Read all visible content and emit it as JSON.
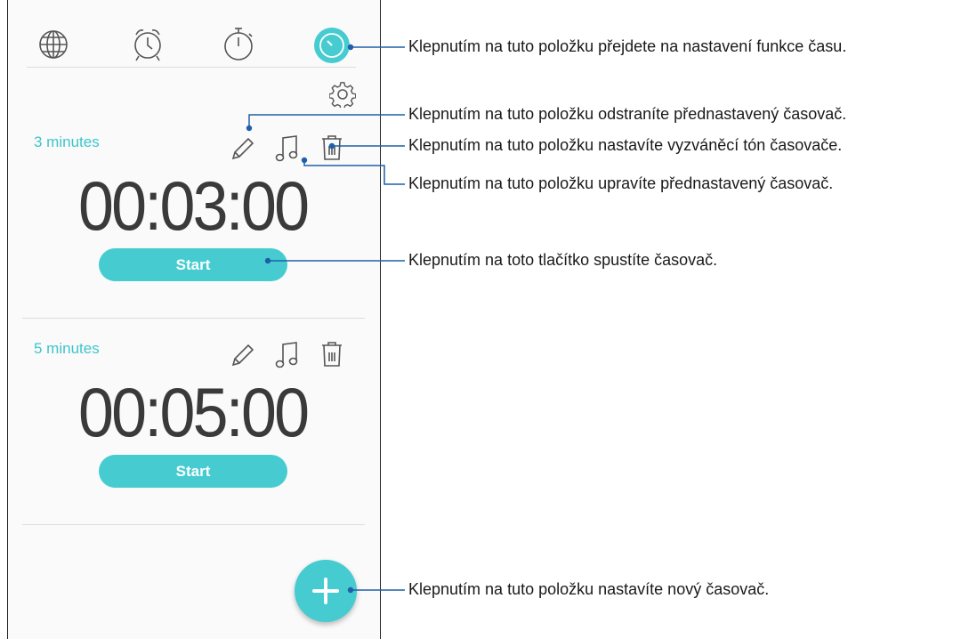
{
  "tabs": [
    {
      "name": "world-clock",
      "icon": "globe-icon"
    },
    {
      "name": "alarm",
      "icon": "alarm-clock-icon"
    },
    {
      "name": "stopwatch",
      "icon": "stopwatch-icon"
    },
    {
      "name": "timer",
      "icon": "timer-icon",
      "active": true
    }
  ],
  "timers": [
    {
      "label": "3 minutes",
      "time": "00:03:00",
      "start_label": "Start"
    },
    {
      "label": "5 minutes",
      "time": "00:05:00",
      "start_label": "Start"
    }
  ],
  "icons": {
    "settings": "gear-icon",
    "edit": "pencil-icon",
    "ringtone": "music-note-icon",
    "delete": "trash-icon",
    "add": "plus-icon"
  },
  "callouts": {
    "timer_settings": "Klepnutím na tuto položku přejdete na nastavení funkce času.",
    "delete_preset": "Klepnutím na tuto položku odstraníte přednastavený časovač.",
    "ringtone": "Klepnutím na tuto položku nastavíte vyzváněcí tón časovače.",
    "edit_preset": "Klepnutím na tuto položku upravíte přednastavený časovač.",
    "start": "Klepnutím na toto tlačítko spustíte časovač.",
    "new_timer": "Klepnutím na tuto položku nastavíte nový časovač."
  },
  "colors": {
    "accent": "#46ccd0",
    "callout_line": "#1f5fa8"
  }
}
